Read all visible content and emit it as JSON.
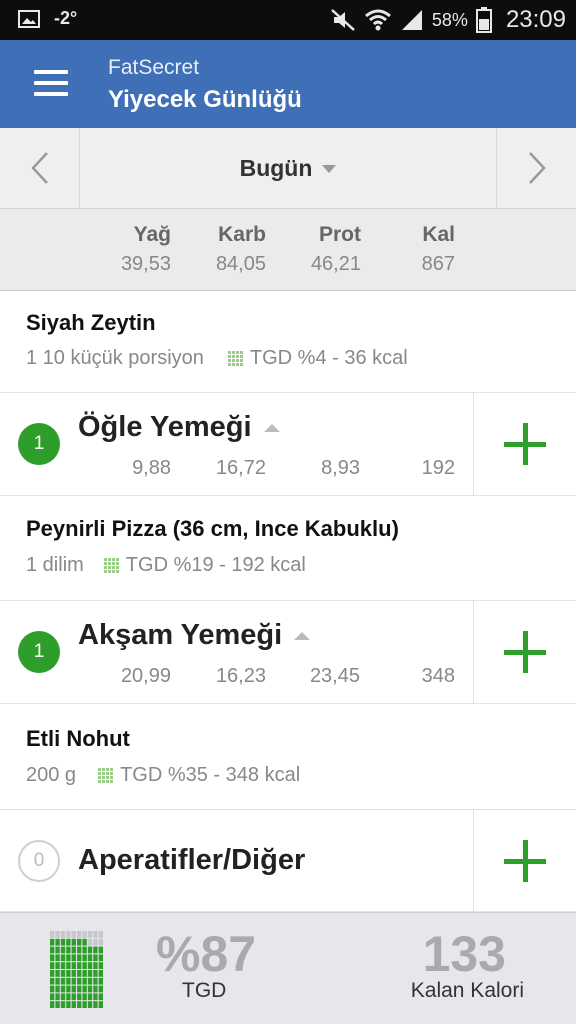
{
  "status_bar": {
    "temperature": "-2°",
    "battery": "58%",
    "time": "23:09"
  },
  "app_bar": {
    "app_name": "FatSecret",
    "title": "Yiyecek Günlüğü"
  },
  "date_nav": {
    "label": "Bugün"
  },
  "totals": {
    "headers": {
      "fat": "Yağ",
      "carb": "Karb",
      "prot": "Prot",
      "cal": "Kal"
    },
    "values": {
      "fat": "39,53",
      "carb": "84,05",
      "prot": "46,21",
      "cal": "867"
    }
  },
  "breakfast_item": {
    "name": "Siyah Zeytin",
    "serving": "1 10 küçük porsiyon",
    "rdi": "TGD %4 - 36 kcal"
  },
  "lunch": {
    "count": "1",
    "name": "Öğle Yemeği",
    "fat": "9,88",
    "carb": "16,72",
    "prot": "8,93",
    "cal": "192",
    "item": {
      "name": "Peynirli Pizza (36 cm, Ince Kabuklu)",
      "serving": "1  dilim",
      "rdi": "TGD %19 - 192 kcal"
    }
  },
  "dinner": {
    "count": "1",
    "name": "Akşam Yemeği",
    "fat": "20,99",
    "carb": "16,23",
    "prot": "23,45",
    "cal": "348",
    "item": {
      "name": "Etli Nohut",
      "serving": "200  g",
      "rdi": "TGD %35 - 348 kcal"
    }
  },
  "snacks": {
    "count": "0",
    "name": "Aperatifler/Diğer"
  },
  "summary": {
    "rdi_percent": "%87",
    "rdi_label": "TGD",
    "remaining": "133",
    "remaining_label": "Kalan Kalori",
    "rdi_fill": 0.87
  },
  "colors": {
    "app_bar": "#3f6fb6",
    "accent_green": "#2e9e2a",
    "status_bar": "#0d0d0d"
  },
  "icons": [
    "image-icon",
    "mute-icon",
    "wifi-icon",
    "signal-icon",
    "battery-icon",
    "menu-icon",
    "chevron-left-icon",
    "chevron-right-icon",
    "dropdown-icon",
    "grid-icon",
    "plus-icon"
  ]
}
